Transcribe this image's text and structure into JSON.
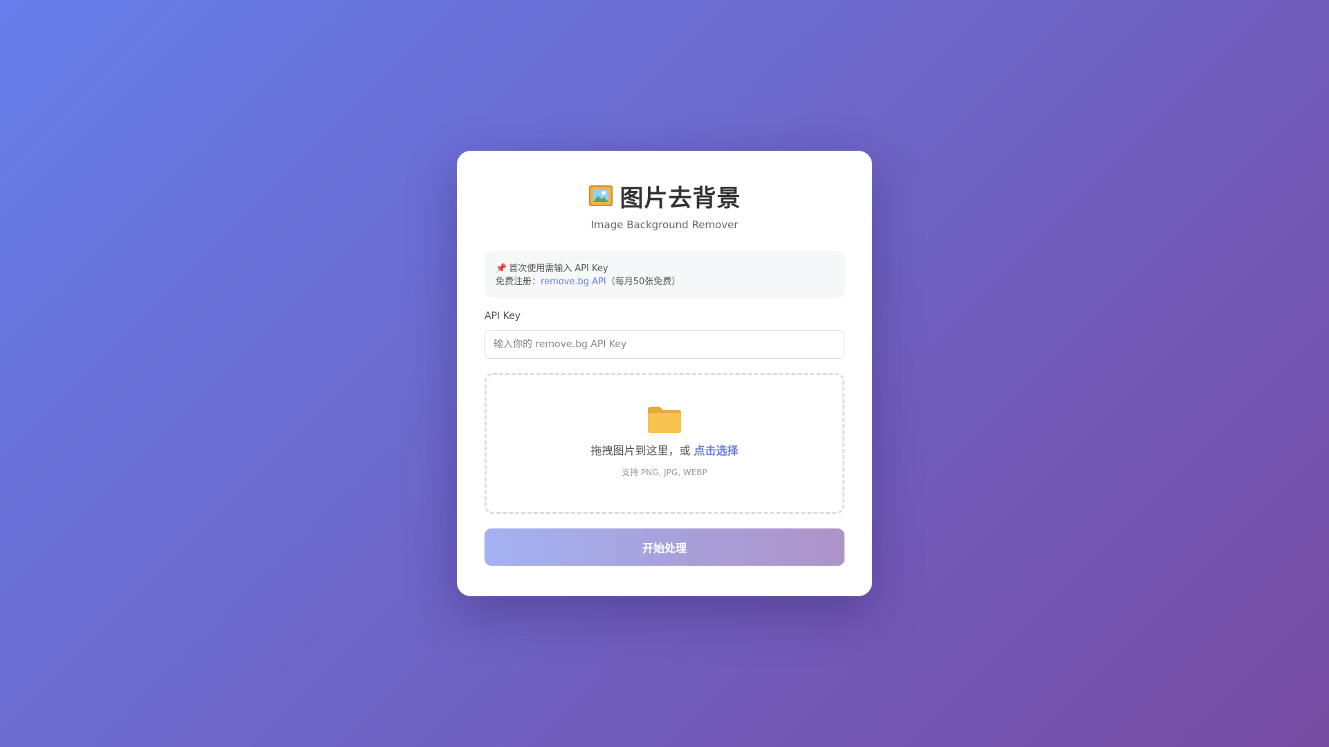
{
  "header": {
    "icon": "framed-picture-icon",
    "title": "图片去背景",
    "subtitle": "Image Background Remover"
  },
  "notice": {
    "icon": "pushpin-icon",
    "line1": "首次使用需输入 API Key",
    "line2_prefix": "免费注册：",
    "link_text": "remove.bg API",
    "line2_suffix": "（每月50张免费）"
  },
  "api_key": {
    "label": "API Key",
    "placeholder": "输入你的 remove.bg API Key",
    "value": ""
  },
  "dropzone": {
    "icon": "folder-icon",
    "text": "拖拽图片到这里，或",
    "link_text": "点击选择",
    "hint": "支持 PNG, JPG, WEBP"
  },
  "actions": {
    "process_label": "开始处理",
    "enabled": false
  },
  "colors": {
    "accent": "#667eea",
    "gradient_start": "#667eea",
    "gradient_end": "#764ba2",
    "card_bg": "#ffffff"
  }
}
